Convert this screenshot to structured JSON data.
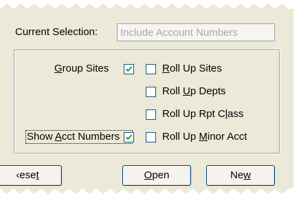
{
  "current_selection": {
    "label": "Current Selection:",
    "value": "Include Account Numbers"
  },
  "options": {
    "group_sites": {
      "before": "",
      "mnemonic": "G",
      "after": "roup Sites",
      "checked": true
    },
    "show_acct_numbers": {
      "before": "Show ",
      "mnemonic": "A",
      "after": "cct Numbers",
      "checked": true
    },
    "roll_up_sites": {
      "before": "",
      "mnemonic": "R",
      "after": "oll Up Sites",
      "checked": false
    },
    "roll_up_depts": {
      "before": "Roll ",
      "mnemonic": "U",
      "after": "p Depts",
      "checked": false
    },
    "roll_up_rpt_class": {
      "before": "Roll Up Rpt C",
      "mnemonic": "l",
      "after": "ass",
      "checked": false
    },
    "roll_up_minor_acct": {
      "before": "Roll Up ",
      "mnemonic": "M",
      "after": "inor Acct",
      "checked": false
    }
  },
  "buttons": {
    "reset": {
      "before": "‹ese",
      "mnemonic": "t",
      "after": ""
    },
    "open": {
      "before": "",
      "mnemonic": "O",
      "after": "pen"
    },
    "new": {
      "before": "Ne",
      "mnemonic": "w",
      "after": ""
    }
  },
  "colors": {
    "panel": "#ece9d8",
    "check_border": "#1c5180",
    "button_border": "#003c74",
    "disabled_text": "#a8a8a8"
  }
}
